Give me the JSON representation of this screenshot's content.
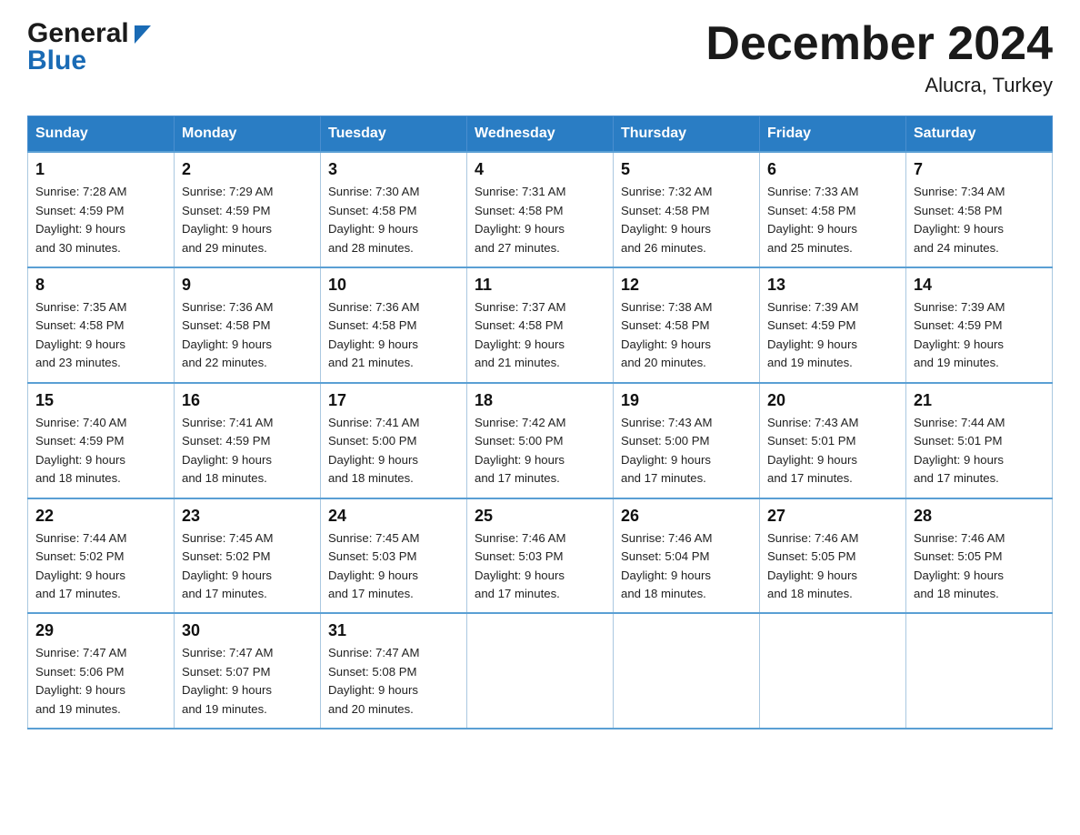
{
  "logo": {
    "line1": "General",
    "arrow": "▼",
    "line2": "Blue"
  },
  "title": "December 2024",
  "subtitle": "Alucra, Turkey",
  "days_of_week": [
    "Sunday",
    "Monday",
    "Tuesday",
    "Wednesday",
    "Thursday",
    "Friday",
    "Saturday"
  ],
  "weeks": [
    [
      {
        "num": "1",
        "sunrise": "7:28 AM",
        "sunset": "4:59 PM",
        "daylight": "9 hours and 30 minutes."
      },
      {
        "num": "2",
        "sunrise": "7:29 AM",
        "sunset": "4:59 PM",
        "daylight": "9 hours and 29 minutes."
      },
      {
        "num": "3",
        "sunrise": "7:30 AM",
        "sunset": "4:58 PM",
        "daylight": "9 hours and 28 minutes."
      },
      {
        "num": "4",
        "sunrise": "7:31 AM",
        "sunset": "4:58 PM",
        "daylight": "9 hours and 27 minutes."
      },
      {
        "num": "5",
        "sunrise": "7:32 AM",
        "sunset": "4:58 PM",
        "daylight": "9 hours and 26 minutes."
      },
      {
        "num": "6",
        "sunrise": "7:33 AM",
        "sunset": "4:58 PM",
        "daylight": "9 hours and 25 minutes."
      },
      {
        "num": "7",
        "sunrise": "7:34 AM",
        "sunset": "4:58 PM",
        "daylight": "9 hours and 24 minutes."
      }
    ],
    [
      {
        "num": "8",
        "sunrise": "7:35 AM",
        "sunset": "4:58 PM",
        "daylight": "9 hours and 23 minutes."
      },
      {
        "num": "9",
        "sunrise": "7:36 AM",
        "sunset": "4:58 PM",
        "daylight": "9 hours and 22 minutes."
      },
      {
        "num": "10",
        "sunrise": "7:36 AM",
        "sunset": "4:58 PM",
        "daylight": "9 hours and 21 minutes."
      },
      {
        "num": "11",
        "sunrise": "7:37 AM",
        "sunset": "4:58 PM",
        "daylight": "9 hours and 21 minutes."
      },
      {
        "num": "12",
        "sunrise": "7:38 AM",
        "sunset": "4:58 PM",
        "daylight": "9 hours and 20 minutes."
      },
      {
        "num": "13",
        "sunrise": "7:39 AM",
        "sunset": "4:59 PM",
        "daylight": "9 hours and 19 minutes."
      },
      {
        "num": "14",
        "sunrise": "7:39 AM",
        "sunset": "4:59 PM",
        "daylight": "9 hours and 19 minutes."
      }
    ],
    [
      {
        "num": "15",
        "sunrise": "7:40 AM",
        "sunset": "4:59 PM",
        "daylight": "9 hours and 18 minutes."
      },
      {
        "num": "16",
        "sunrise": "7:41 AM",
        "sunset": "4:59 PM",
        "daylight": "9 hours and 18 minutes."
      },
      {
        "num": "17",
        "sunrise": "7:41 AM",
        "sunset": "5:00 PM",
        "daylight": "9 hours and 18 minutes."
      },
      {
        "num": "18",
        "sunrise": "7:42 AM",
        "sunset": "5:00 PM",
        "daylight": "9 hours and 17 minutes."
      },
      {
        "num": "19",
        "sunrise": "7:43 AM",
        "sunset": "5:00 PM",
        "daylight": "9 hours and 17 minutes."
      },
      {
        "num": "20",
        "sunrise": "7:43 AM",
        "sunset": "5:01 PM",
        "daylight": "9 hours and 17 minutes."
      },
      {
        "num": "21",
        "sunrise": "7:44 AM",
        "sunset": "5:01 PM",
        "daylight": "9 hours and 17 minutes."
      }
    ],
    [
      {
        "num": "22",
        "sunrise": "7:44 AM",
        "sunset": "5:02 PM",
        "daylight": "9 hours and 17 minutes."
      },
      {
        "num": "23",
        "sunrise": "7:45 AM",
        "sunset": "5:02 PM",
        "daylight": "9 hours and 17 minutes."
      },
      {
        "num": "24",
        "sunrise": "7:45 AM",
        "sunset": "5:03 PM",
        "daylight": "9 hours and 17 minutes."
      },
      {
        "num": "25",
        "sunrise": "7:46 AM",
        "sunset": "5:03 PM",
        "daylight": "9 hours and 17 minutes."
      },
      {
        "num": "26",
        "sunrise": "7:46 AM",
        "sunset": "5:04 PM",
        "daylight": "9 hours and 18 minutes."
      },
      {
        "num": "27",
        "sunrise": "7:46 AM",
        "sunset": "5:05 PM",
        "daylight": "9 hours and 18 minutes."
      },
      {
        "num": "28",
        "sunrise": "7:46 AM",
        "sunset": "5:05 PM",
        "daylight": "9 hours and 18 minutes."
      }
    ],
    [
      {
        "num": "29",
        "sunrise": "7:47 AM",
        "sunset": "5:06 PM",
        "daylight": "9 hours and 19 minutes."
      },
      {
        "num": "30",
        "sunrise": "7:47 AM",
        "sunset": "5:07 PM",
        "daylight": "9 hours and 19 minutes."
      },
      {
        "num": "31",
        "sunrise": "7:47 AM",
        "sunset": "5:08 PM",
        "daylight": "9 hours and 20 minutes."
      },
      null,
      null,
      null,
      null
    ]
  ],
  "labels": {
    "sunrise": "Sunrise:",
    "sunset": "Sunset:",
    "daylight": "Daylight:"
  }
}
